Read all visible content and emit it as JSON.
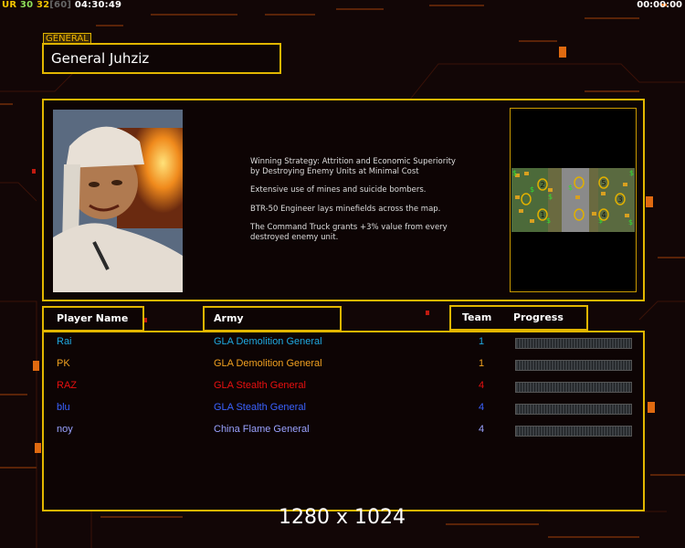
{
  "hud": {
    "ur": "UR",
    "val1": "30",
    "val2": "32",
    "val3": "[60]",
    "clock": "04:30:49",
    "timer": "00:00:00"
  },
  "general": {
    "tag": "GENERAL",
    "title": "General Juhziz",
    "description": [
      "Winning Strategy: Attrition and Economic Superiority\n by Destroying Enemy Units at Minimal Cost",
      "Extensive use of mines and suicide bombers.",
      "BTR-50 Engineer lays minefields across the map.",
      "The Command Truck grants +3% value from every\n destroyed enemy unit."
    ],
    "map_slots": [
      "1",
      "2",
      "3",
      "4",
      "5"
    ]
  },
  "columns": {
    "player": "Player Name",
    "army": "Army",
    "team": "Team",
    "progress": "Progress"
  },
  "players": [
    {
      "name": "Rai",
      "army": "GLA Demolition General",
      "team": "1",
      "color": "#1fa8e0",
      "progress": 0
    },
    {
      "name": "PK",
      "army": "GLA Demolition General",
      "team": "1",
      "color": "#f0a020",
      "progress": 0
    },
    {
      "name": "RAZ",
      "army": "GLA Stealth General",
      "team": "4",
      "color": "#e81010",
      "progress": 0
    },
    {
      "name": "blu",
      "army": "GLA Stealth General",
      "team": "4",
      "color": "#3a62ff",
      "progress": 0
    },
    {
      "name": "noy",
      "army": "China Flame General",
      "team": "4",
      "color": "#9aa2ff",
      "progress": 0
    }
  ],
  "resolution": "1280 x 1024"
}
